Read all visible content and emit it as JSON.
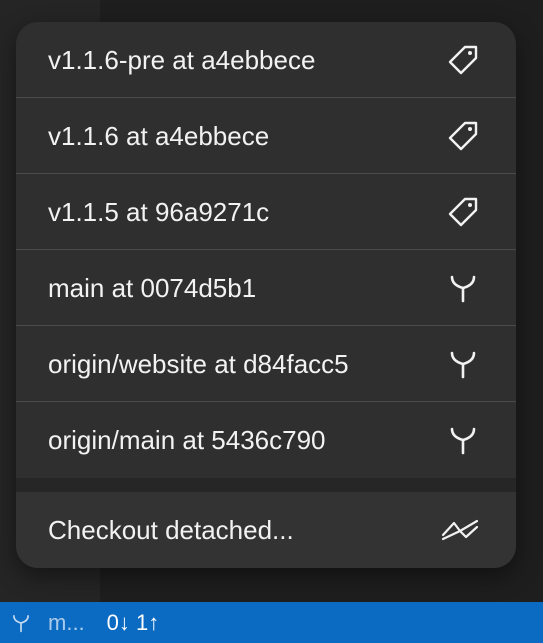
{
  "menu": {
    "items": [
      {
        "label": "v1.1.6-pre at a4ebbece",
        "icon": "tag-icon"
      },
      {
        "label": "v1.1.6 at a4ebbece",
        "icon": "tag-icon"
      },
      {
        "label": "v1.1.5 at 96a9271c",
        "icon": "tag-icon"
      },
      {
        "label": "main at 0074d5b1",
        "icon": "branch-icon"
      },
      {
        "label": "origin/website at d84facc5",
        "icon": "branch-icon"
      },
      {
        "label": "origin/main at 5436c790",
        "icon": "branch-icon"
      }
    ],
    "detached": {
      "label": "Checkout detached...",
      "icon": "detached-icon"
    }
  },
  "statusbar": {
    "branch_name": "m...",
    "sync": "0↓ 1↑"
  },
  "colors": {
    "statusbar": "#0b6ac2",
    "menu_bg": "#2f2f2f"
  }
}
